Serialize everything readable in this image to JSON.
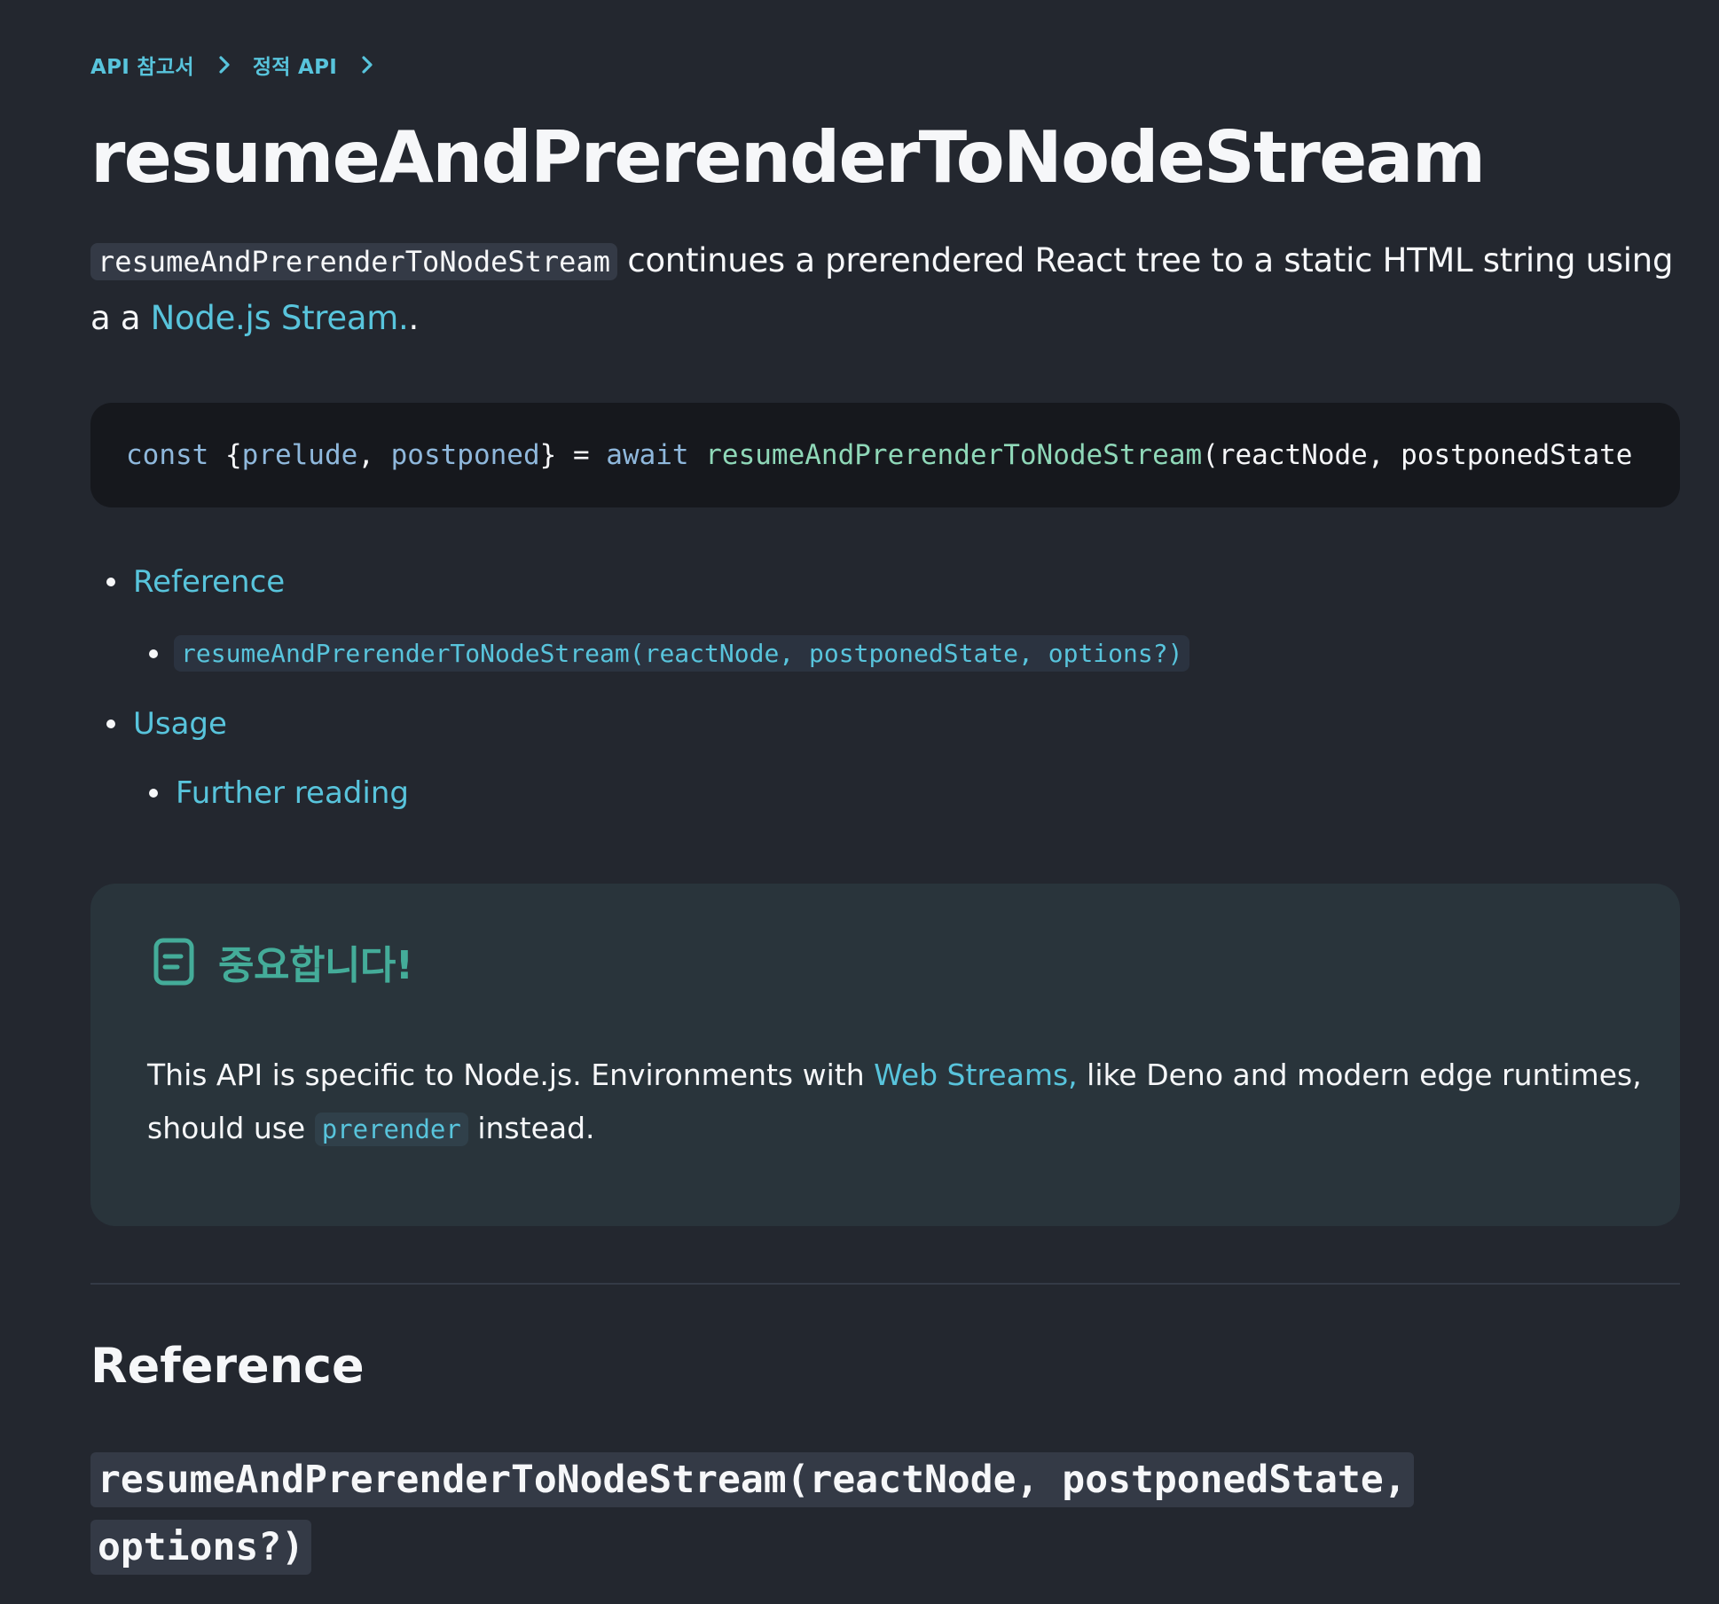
{
  "breadcrumb": {
    "items": [
      "API 참고서",
      "정적 API"
    ]
  },
  "page": {
    "title": "resumeAndPrerenderToNodeStream"
  },
  "intro": {
    "code": "resumeAndPrerenderToNodeStream",
    "text_before_link": " continues a prerendered React tree to a static HTML string using a a ",
    "link": "Node.js Stream.",
    "text_after_link": "."
  },
  "code_block": {
    "tokens": [
      "const ",
      "{",
      "prelude",
      ", ",
      "postponed",
      "} = ",
      "await ",
      "resumeAndPrerenderToNodeStream",
      "(reactNode, postponedState"
    ]
  },
  "toc": {
    "reference": "Reference",
    "reference_sig": "resumeAndPrerenderToNodeStream(reactNode, postponedState, options?)",
    "usage": "Usage",
    "further_reading": "Further reading"
  },
  "note": {
    "icon": "note-icon",
    "title": "중요합니다!",
    "text_before_link": "This API is specific to Node.js. Environments with ",
    "link": "Web Streams,",
    "text_middle": " like Deno and modern edge runtimes, should use ",
    "code": "prerender",
    "text_after": " instead."
  },
  "reference": {
    "heading": "Reference",
    "signature_line1": "resumeAndPrerenderToNodeStream(reactNode, postponedState,",
    "signature_line2": "options?)"
  },
  "colors": {
    "background": "#23272f",
    "link": "#58c4dc",
    "code_block_bg": "#16181d",
    "note_bg": "#29343b",
    "note_accent": "#44ac99"
  }
}
